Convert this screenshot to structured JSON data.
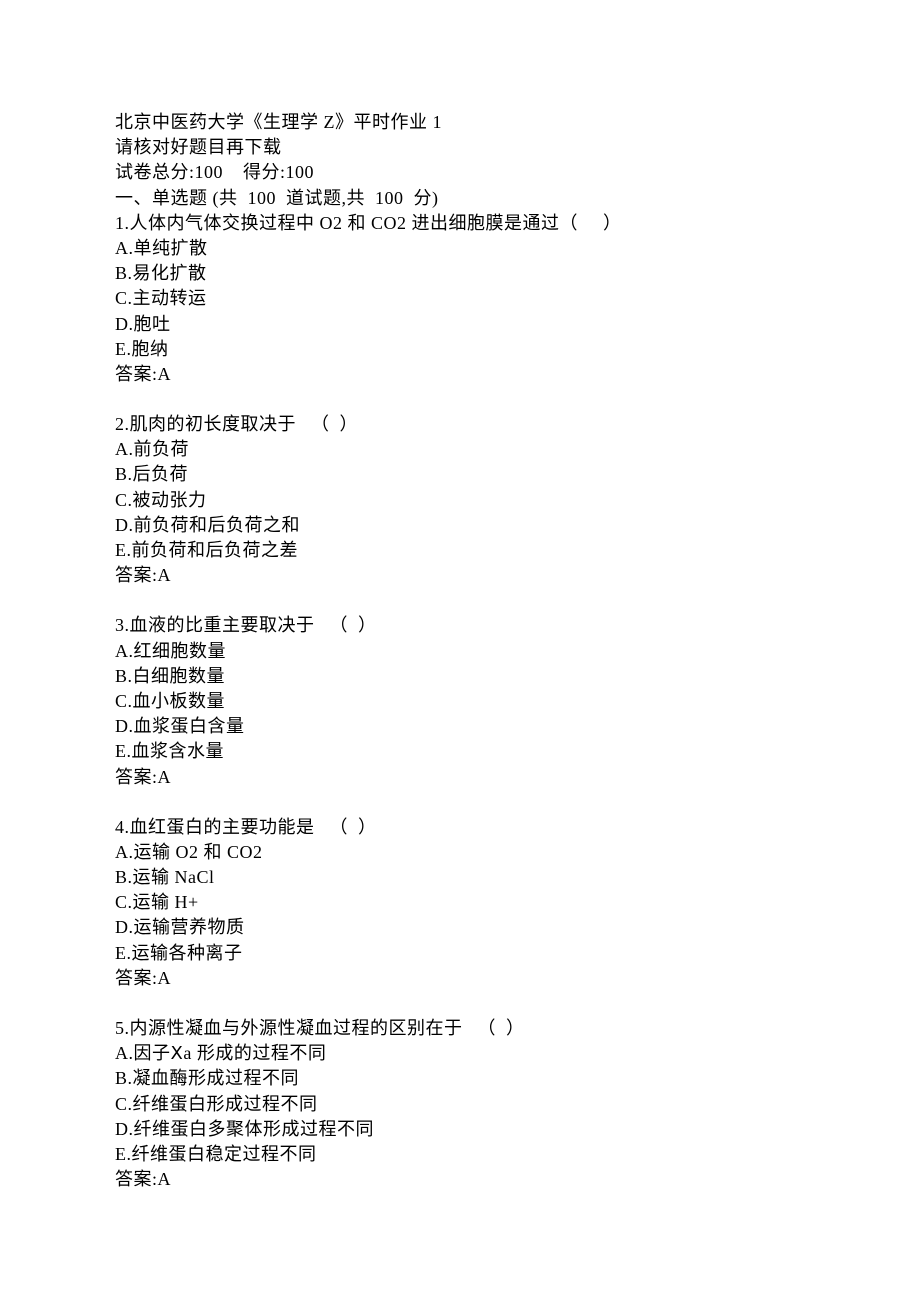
{
  "header": {
    "title": "北京中医药大学《生理学 Z》平时作业 1",
    "instruction": "请核对好题目再下载",
    "score_line": "试卷总分:100    得分:100",
    "section_title": "一、单选题 (共  100  道试题,共  100  分)"
  },
  "questions": [
    {
      "stem": "1.人体内气体交换过程中 O2 和 CO2 进出细胞膜是通过（     ）",
      "options": [
        "A.单纯扩散",
        "B.易化扩散",
        "C.主动转运",
        "D.胞吐",
        "E.胞纳"
      ],
      "answer": "答案:A"
    },
    {
      "stem": "2.肌肉的初长度取决于   （  ）",
      "options": [
        "A.前负荷",
        "B.后负荷",
        "C.被动张力",
        "D.前负荷和后负荷之和",
        "E.前负荷和后负荷之差"
      ],
      "answer": "答案:A"
    },
    {
      "stem": "3.血液的比重主要取决于   （  ）",
      "options": [
        "A.红细胞数量",
        "B.白细胞数量",
        "C.血小板数量",
        "D.血浆蛋白含量",
        "E.血浆含水量"
      ],
      "answer": "答案:A"
    },
    {
      "stem": "4.血红蛋白的主要功能是   （  ）",
      "options": [
        "A.运输 O2 和 CO2",
        "B.运输 NaCl",
        "C.运输 H+",
        "D.运输营养物质",
        "E.运输各种离子"
      ],
      "answer": "答案:A"
    },
    {
      "stem": "5.内源性凝血与外源性凝血过程的区别在于   （  ）",
      "options": [
        "A.因子Ⅹa 形成的过程不同",
        "B.凝血酶形成过程不同",
        "C.纤维蛋白形成过程不同",
        "D.纤维蛋白多聚体形成过程不同",
        "E.纤维蛋白稳定过程不同"
      ],
      "answer": "答案:A"
    }
  ]
}
